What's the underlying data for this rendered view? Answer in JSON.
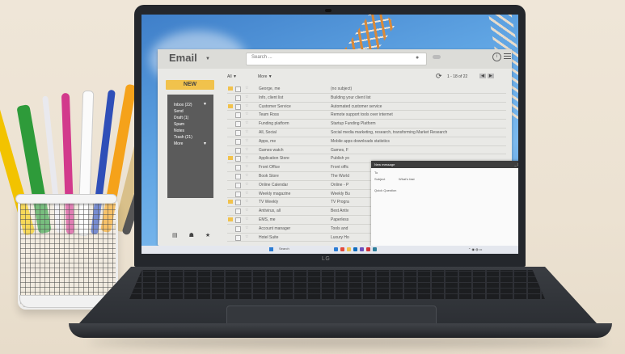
{
  "app": {
    "brand": "Email",
    "search_placeholder": "Search ...",
    "pagination": "1 - 18 of 22",
    "new_label": "NEW",
    "filter_all": "All",
    "filter_more": "More"
  },
  "folders": [
    {
      "label": "Inbox (22)"
    },
    {
      "label": "Send"
    },
    {
      "label": "Draft (1)"
    },
    {
      "label": "Spam"
    },
    {
      "label": "Notes"
    },
    {
      "label": "Trash (21)"
    },
    {
      "label": "More"
    }
  ],
  "emails": [
    {
      "from": "George, me",
      "subject": "(no subject)",
      "flag": "#f1c24c"
    },
    {
      "from": "Info, client list",
      "subject": "Building your client list",
      "flag": ""
    },
    {
      "from": "Customer Service",
      "subject": "Automated customer service",
      "flag": "#f1c24c"
    },
    {
      "from": "Team Ross",
      "subject": "Remote support tools over internet",
      "flag": ""
    },
    {
      "from": "Funding platform",
      "subject": "Startup Funding Platform",
      "flag": ""
    },
    {
      "from": "All, Social",
      "subject": "Social media marketing, research, transforming Market Research",
      "flag": ""
    },
    {
      "from": "Apps, me",
      "subject": "Mobile apps downloads statistics",
      "flag": ""
    },
    {
      "from": "Games watch",
      "subject": "Games, F",
      "flag": ""
    },
    {
      "from": "Application Store",
      "subject": "Publish yo",
      "flag": "#f1c24c"
    },
    {
      "from": "Front Office",
      "subject": "Front offic",
      "flag": ""
    },
    {
      "from": "Book Store",
      "subject": "The World",
      "flag": ""
    },
    {
      "from": "Online Calendar",
      "subject": "Online - P",
      "flag": ""
    },
    {
      "from": "Weekly magazine",
      "subject": "Weekly Bu",
      "flag": ""
    },
    {
      "from": "TV Weekly",
      "subject": "TV Progra",
      "flag": "#f1c24c"
    },
    {
      "from": "Antivirus, all",
      "subject": "Best Antiv",
      "flag": ""
    },
    {
      "from": "EMS, me",
      "subject": "Paperless",
      "flag": "#f1c24c"
    },
    {
      "from": "Account manager",
      "subject": "Tools and",
      "flag": ""
    },
    {
      "from": "Hotel Suite",
      "subject": "Luxury Ho",
      "flag": ""
    }
  ],
  "compose": {
    "title": "New message",
    "to_label": "To",
    "subject_label": "Subject",
    "subject_value": "What's fast",
    "body": "Quick Question",
    "send_label": "Send"
  },
  "taskbar": {
    "search_label": "Search"
  },
  "laptop_brand": "LG",
  "colors": {
    "accent": "#f1c24c",
    "sidebar": "#5b5b5b",
    "wallpaper": "#5fa4e3"
  }
}
